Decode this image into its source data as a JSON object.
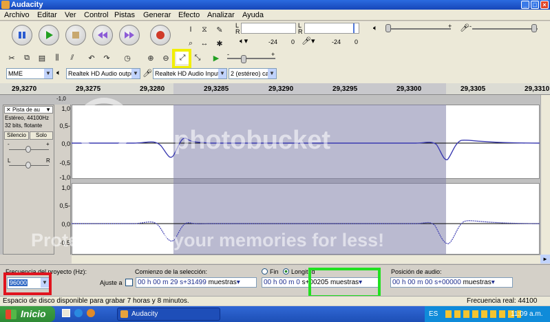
{
  "window": {
    "title": "Audacity",
    "controls": [
      "_",
      "□",
      "×"
    ]
  },
  "menu": [
    "Archivo",
    "Editar",
    "Ver",
    "Control",
    "Pistas",
    "Generar",
    "Efecto",
    "Analizar",
    "Ayuda"
  ],
  "meters": {
    "left_label": "L",
    "right_label": "R",
    "playback_scale": [
      "-24",
      "0"
    ],
    "record_scale": [
      "-24",
      "0"
    ]
  },
  "mixer": {
    "plus": "+",
    "minus": "-"
  },
  "devices": {
    "host": "MME",
    "output": "Realtek HD Audio outpu",
    "input": "Realtek HD Audio Input",
    "channels": "2 (estéreo) ca"
  },
  "ruler": {
    "ticks": [
      "29,3270",
      "29,3275",
      "29,3280",
      "29,3285",
      "29,3290",
      "29,3295",
      "29,3300",
      "29,3305",
      "29,3310"
    ]
  },
  "track": {
    "name": "Pista de au",
    "info1": "Estéreo, 44100Hz",
    "info2": "32 bits, flotante",
    "mute": "Silencio",
    "solo": "Solo",
    "pan_l": "L",
    "pan_r": "R",
    "gain_minus": "-",
    "gain_plus": "+",
    "axis_top": [
      "1,0",
      "0,5-",
      "0,0",
      "-0,5",
      "-1,0"
    ],
    "axis_bottom": [
      "1,0",
      "0,5-",
      "0,0",
      "-0,5"
    ],
    "top_partial": "-1,0"
  },
  "selection_bar": {
    "rate_label": "Frecuencia del proyecto (Hz):",
    "rate_value": "96000",
    "start_label": "Comienzo de la selección:",
    "snap_label": "Ajuste a",
    "start_time": "00 h 00 m 29 s+31499",
    "start_unit": "muestras",
    "end_label": "Fin",
    "length_label": "Longitud",
    "length_time": "00 h 00 m 0",
    "length_value": "s+00205",
    "length_unit": "muestras",
    "audio_pos_label": "Posición de audio:",
    "audio_pos_time": "00 h 00 m 00 s+00000",
    "audio_pos_unit": "muestras"
  },
  "status": {
    "left": "Espacio de disco disponible para grabar 7 horas y 8 minutos.",
    "right": "Frecuencia real: 44100"
  },
  "taskbar": {
    "start": "Inicio",
    "task": "Audacity",
    "lang": "ES",
    "clock": "11:09 a.m."
  },
  "watermark": {
    "logo": "photobucket",
    "tagline": "Protect more of your memories for less!"
  },
  "colors": {
    "highlight_red": "#e0141e",
    "highlight_yellow": "#f2ef00",
    "highlight_green": "#22e020",
    "waveform": "#3a3ab0",
    "selection": "#b8b8c4"
  }
}
